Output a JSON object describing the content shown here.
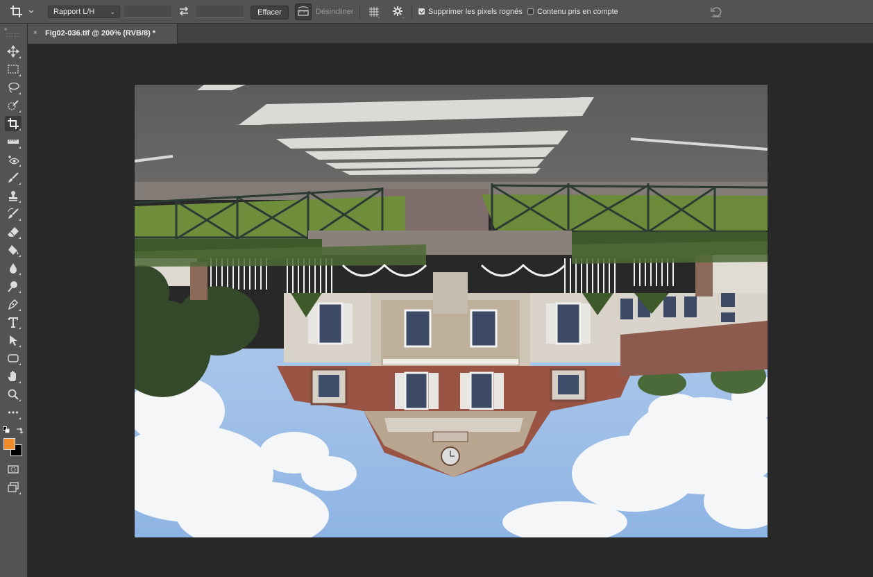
{
  "options_bar": {
    "ratio_select": "Rapport L/H",
    "clear_button": "Effacer",
    "straighten_label": "Désincliner",
    "delete_cropped_label": "Supprimer les pixels rognés",
    "delete_cropped_checked": true,
    "content_aware_label": "Contenu pris en compte",
    "content_aware_checked": false
  },
  "document_tab": {
    "close_glyph": "×",
    "title": "Fig02-036.tif @ 200% (RVB/8) *"
  },
  "tools": [
    "move-tool",
    "rectangular-marquee-tool",
    "lasso-tool",
    "quick-selection-tool",
    "crop-tool",
    "ruler-tool",
    "red-eye-tool",
    "brush-tool",
    "clone-stamp-tool",
    "history-brush-tool",
    "eraser-tool",
    "paint-bucket-tool",
    "blur-tool",
    "dodge-tool",
    "pen-tool",
    "type-tool",
    "path-selection-tool",
    "rectangle-tool",
    "hand-tool",
    "zoom-tool",
    "more-tools"
  ],
  "active_tool": "crop-tool",
  "colors": {
    "foreground": "#f08c2a",
    "background": "#000000",
    "accent": "#f08c2a"
  }
}
